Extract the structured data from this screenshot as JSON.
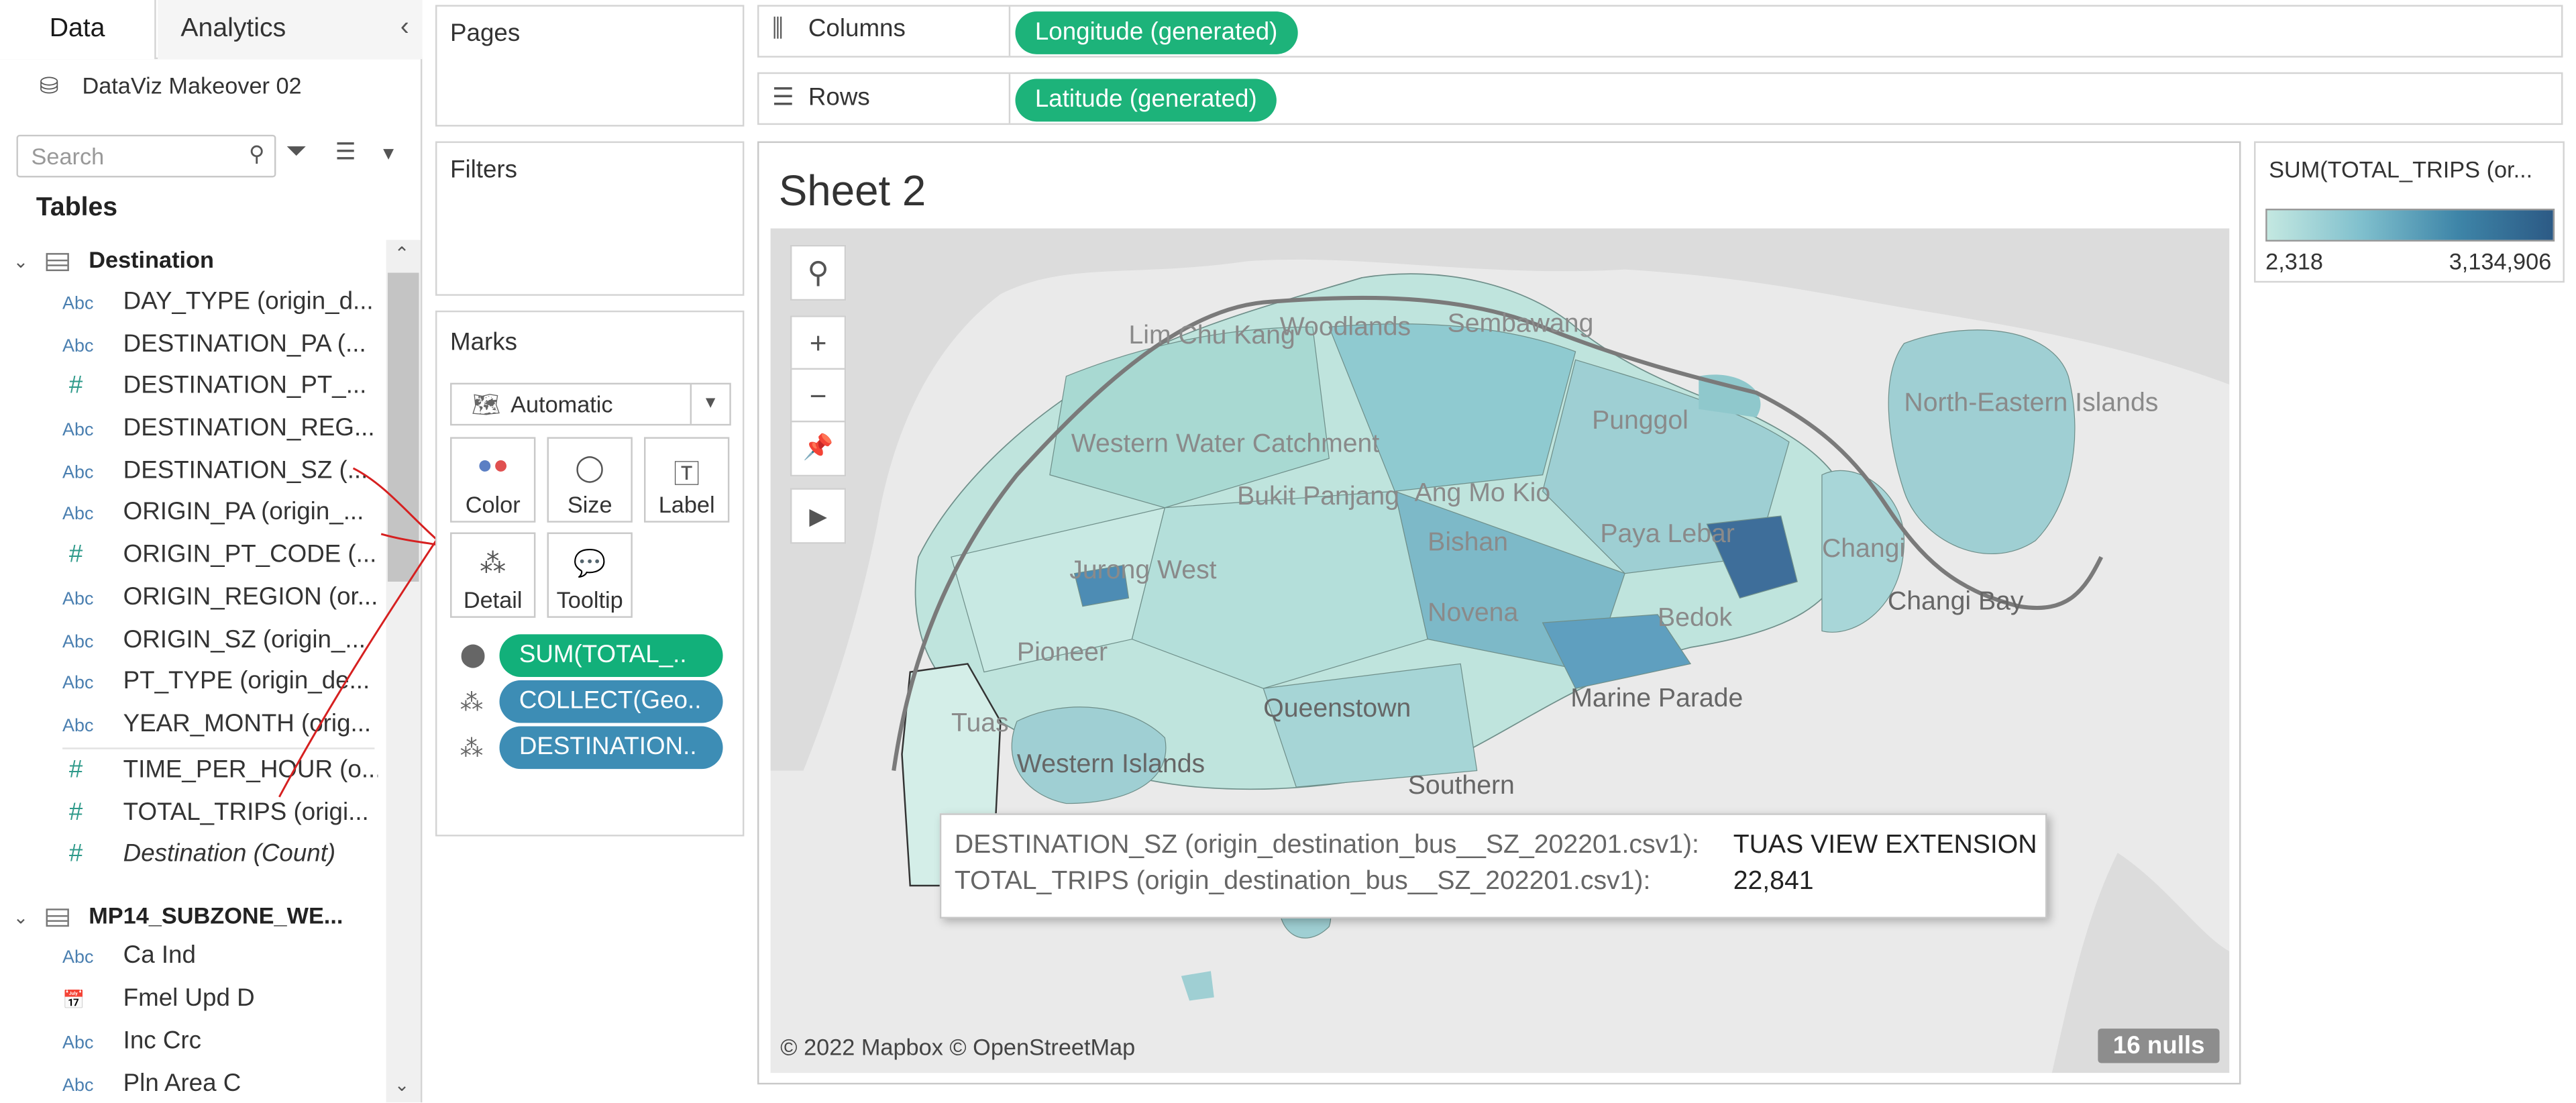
{
  "data_pane": {
    "tabs": [
      "Data",
      "Analytics"
    ],
    "datasource": "DataViz Makeover 02",
    "search_placeholder": "Search",
    "tables_header": "Tables",
    "tables": [
      {
        "name": "Destination",
        "fields": [
          {
            "type": "Abc",
            "name": "DAY_TYPE (origin_d..."
          },
          {
            "type": "Abc",
            "name": "DESTINATION_PA (..."
          },
          {
            "type": "#",
            "name": "DESTINATION_PT_..."
          },
          {
            "type": "Abc",
            "name": "DESTINATION_REG..."
          },
          {
            "type": "Abc",
            "name": "DESTINATION_SZ (..."
          },
          {
            "type": "Abc",
            "name": "ORIGIN_PA (origin_..."
          },
          {
            "type": "#",
            "name": "ORIGIN_PT_CODE (..."
          },
          {
            "type": "Abc",
            "name": "ORIGIN_REGION (or..."
          },
          {
            "type": "Abc",
            "name": "ORIGIN_SZ (origin_..."
          },
          {
            "type": "Abc",
            "name": "PT_TYPE (origin_de..."
          },
          {
            "type": "Abc",
            "name": "YEAR_MONTH (orig..."
          },
          {
            "type": "#",
            "name": "TIME_PER_HOUR (o..."
          },
          {
            "type": "#",
            "name": "TOTAL_TRIPS (origi..."
          },
          {
            "type": "#",
            "name": "Destination (Count)"
          }
        ]
      },
      {
        "name": "MP14_SUBZONE_WE...",
        "fields": [
          {
            "type": "Abc",
            "name": "Ca Ind"
          },
          {
            "type": "cal",
            "name": "Fmel Upd D"
          },
          {
            "type": "Abc",
            "name": "Inc Crc"
          },
          {
            "type": "Abc",
            "name": "Pln Area C"
          }
        ]
      }
    ]
  },
  "cards": {
    "pages": "Pages",
    "filters": "Filters",
    "marks": "Marks",
    "mark_type": "Automatic",
    "mark_buttons": [
      "Color",
      "Size",
      "Label",
      "Detail",
      "Tooltip"
    ],
    "mark_pills": [
      "SUM(TOTAL_..",
      "COLLECT(Geo..",
      "DESTINATION.."
    ]
  },
  "shelves": {
    "columns_label": "Columns",
    "columns_pill": "Longitude (generated)",
    "rows_label": "Rows",
    "rows_pill": "Latitude (generated)"
  },
  "view": {
    "sheet_title": "Sheet 2",
    "attribution": "© 2022 Mapbox © OpenStreetMap",
    "nulls": "16 nulls",
    "map_labels": [
      "Lim Chu Kang",
      "Woodlands",
      "Sembawang",
      "Western Water Catchment",
      "North-Eastern Islands",
      "Punggol",
      "Changi",
      "Changi Bay",
      "Jurong West",
      "Bukit Panjang",
      "Ang Mo Kio",
      "Bishan",
      "Paya Lebar",
      "Bedok",
      "Marine Parade",
      "Queenstown",
      "Tuas",
      "Western Islands",
      "Southern",
      "Pioneer",
      "Novena"
    ]
  },
  "tooltip": {
    "row1_key": "DESTINATION_SZ (origin_destination_bus__SZ_202201.csv1):",
    "row1_val": "TUAS VIEW EXTENSION",
    "row2_key": "TOTAL_TRIPS (origin_destination_bus__SZ_202201.csv1):",
    "row2_val": "22,841"
  },
  "legend": {
    "title": "SUM(TOTAL_TRIPS (or...",
    "min": "2,318",
    "max": "3,134,906",
    "colors": [
      "#c4e8e1",
      "#7fbfcd",
      "#3e85a8",
      "#2c5a85"
    ]
  }
}
